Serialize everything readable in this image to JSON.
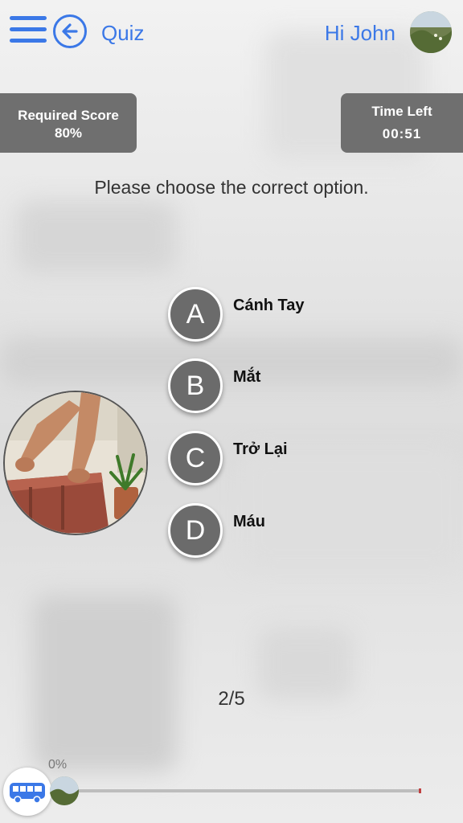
{
  "header": {
    "title": "Quiz",
    "greeting": "Hi John",
    "accent_color": "#3b78e7"
  },
  "score": {
    "label": "Required Score",
    "value": "80%"
  },
  "timer": {
    "label": "Time Left",
    "value": "00:51"
  },
  "prompt": "Please choose the correct option.",
  "options": [
    {
      "letter": "A",
      "text": "Cánh Tay"
    },
    {
      "letter": "B",
      "text": "Mắt"
    },
    {
      "letter": "C",
      "text": "Trở Lại"
    },
    {
      "letter": "D",
      "text": "Máu"
    }
  ],
  "question_counter": "2/5",
  "progress": {
    "percent_label": "0%",
    "fraction": 0
  },
  "icons": {
    "menu": "hamburger-icon",
    "back": "arrow-left-circle-icon",
    "bus": "bus-icon"
  }
}
